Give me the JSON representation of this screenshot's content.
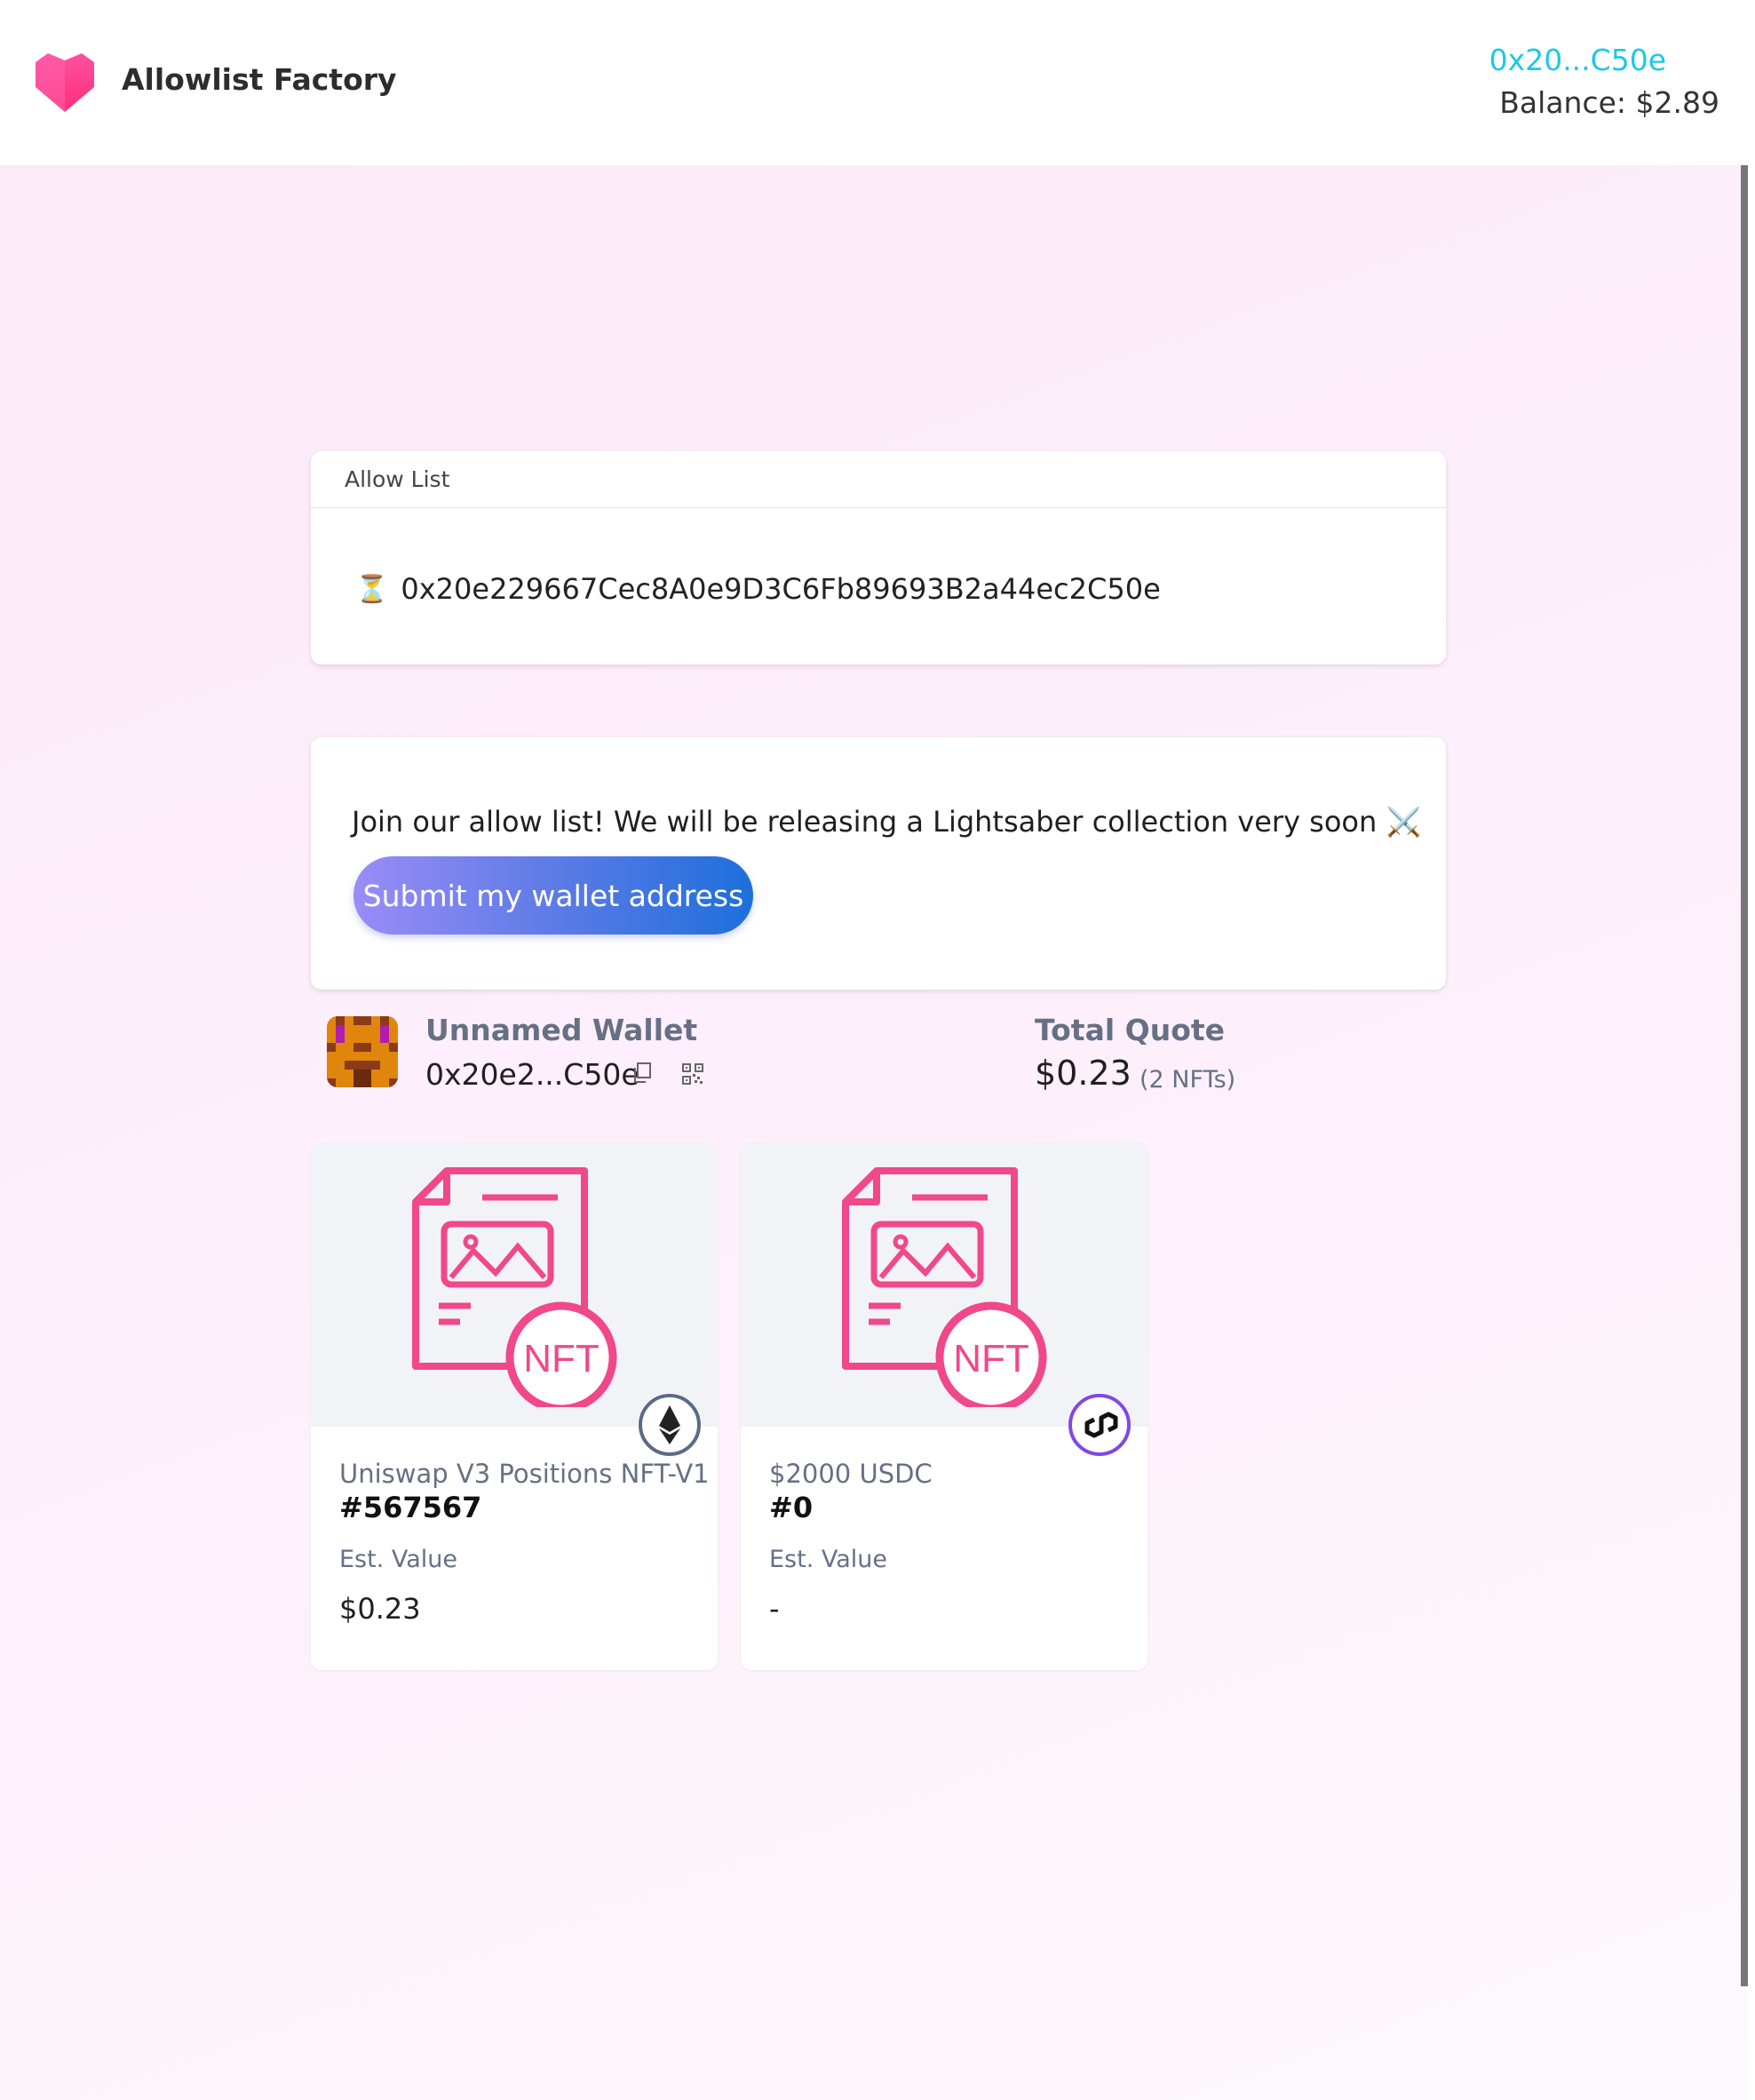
{
  "header": {
    "app_title": "Allowlist Factory",
    "account_short": "0x20...C50e",
    "balance": "Balance: $2.89"
  },
  "allow_list": {
    "title": "Allow List",
    "entries": [
      {
        "status_icon": "hourglass-icon",
        "address": "0x20e229667Cec8A0e9D3C6Fb89693B2a44ec2C50e"
      }
    ]
  },
  "join": {
    "message": "Join our allow list! We will be releasing a Lightsaber collection very soon",
    "message_icon": "crossed-swords-icon",
    "submit_label": "Submit my wallet address"
  },
  "wallet": {
    "name": "Unnamed Wallet",
    "address_short": "0x20e2...C50e",
    "total_quote_label": "Total Quote",
    "total_quote_value": "$0.23",
    "nft_count": "(2 NFTs)"
  },
  "nfts": [
    {
      "collection": "Uniswap V3 Positions NFT-V1",
      "token": "#567567",
      "est_label": "Est. Value",
      "est_value": "$0.23",
      "chain_icon": "ethereum-icon",
      "chain_color": "#5b6b85"
    },
    {
      "collection": "$2000 USDC",
      "token": "#0",
      "est_label": "Est. Value",
      "est_value": "-",
      "chain_icon": "polygon-icon",
      "chain_color": "#8247e5"
    }
  ],
  "colors": {
    "accent_cyan": "#1ec8e6",
    "brand_pink": "#f0488a",
    "button_gradient_start": "#9a8cf7",
    "button_gradient_end": "#1d6fdc"
  }
}
